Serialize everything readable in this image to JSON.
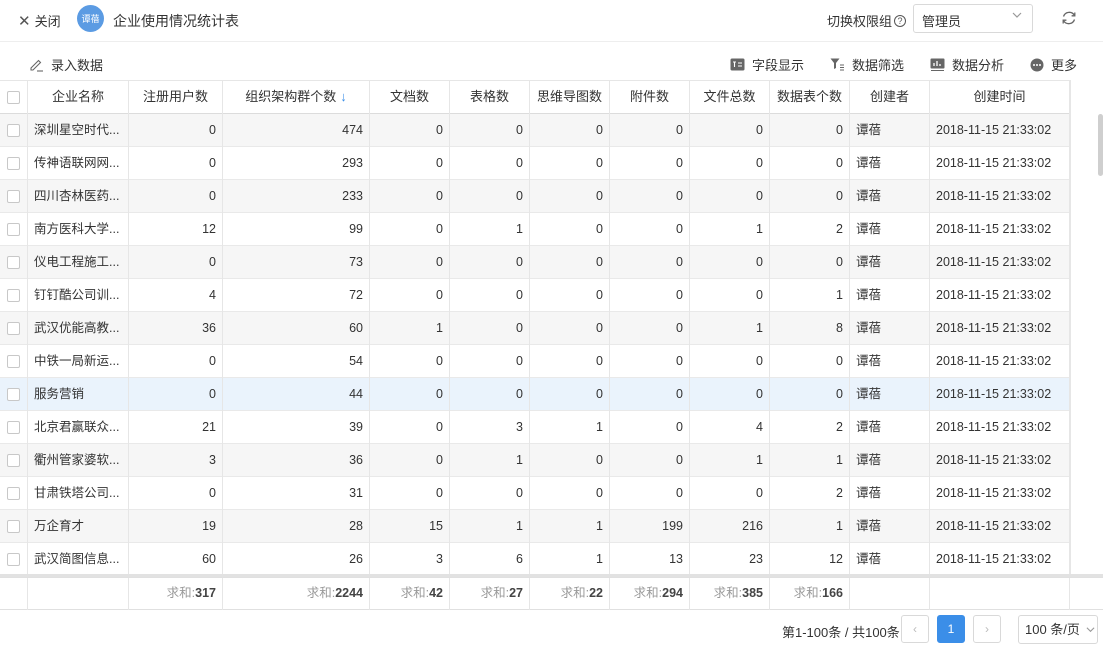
{
  "header": {
    "close_label": "关闭",
    "avatar_text": "谭蓓",
    "title": "企业使用情况统计表",
    "perm_label": "切换权限组",
    "perm_value": "管理员"
  },
  "toolbar": {
    "entry_label": "录入数据",
    "fields_label": "字段显示",
    "filter_label": "数据筛选",
    "analysis_label": "数据分析",
    "more_label": "更多"
  },
  "columns": [
    {
      "label": "企业名称"
    },
    {
      "label": "注册用户数"
    },
    {
      "label": "组织架构群个数",
      "sort": "↓"
    },
    {
      "label": "文档数"
    },
    {
      "label": "表格数"
    },
    {
      "label": "思维导图数"
    },
    {
      "label": "附件数"
    },
    {
      "label": "文件总数"
    },
    {
      "label": "数据表个数"
    },
    {
      "label": "创建者"
    },
    {
      "label": "创建时间"
    }
  ],
  "rows": [
    {
      "name": "深圳星空时代...",
      "users": "0",
      "groups": "474",
      "docs": "0",
      "sheets": "0",
      "minds": "0",
      "attach": "0",
      "files": "0",
      "tables": "0",
      "creator": "谭蓓",
      "created": "2018-11-15 21:33:02"
    },
    {
      "name": "传神语联网网...",
      "users": "0",
      "groups": "293",
      "docs": "0",
      "sheets": "0",
      "minds": "0",
      "attach": "0",
      "files": "0",
      "tables": "0",
      "creator": "谭蓓",
      "created": "2018-11-15 21:33:02"
    },
    {
      "name": "四川杏林医药...",
      "users": "0",
      "groups": "233",
      "docs": "0",
      "sheets": "0",
      "minds": "0",
      "attach": "0",
      "files": "0",
      "tables": "0",
      "creator": "谭蓓",
      "created": "2018-11-15 21:33:02"
    },
    {
      "name": "南方医科大学...",
      "users": "12",
      "groups": "99",
      "docs": "0",
      "sheets": "1",
      "minds": "0",
      "attach": "0",
      "files": "1",
      "tables": "2",
      "creator": "谭蓓",
      "created": "2018-11-15 21:33:02"
    },
    {
      "name": "仪电工程施工...",
      "users": "0",
      "groups": "73",
      "docs": "0",
      "sheets": "0",
      "minds": "0",
      "attach": "0",
      "files": "0",
      "tables": "0",
      "creator": "谭蓓",
      "created": "2018-11-15 21:33:02"
    },
    {
      "name": "钉钉酷公司训...",
      "users": "4",
      "groups": "72",
      "docs": "0",
      "sheets": "0",
      "minds": "0",
      "attach": "0",
      "files": "0",
      "tables": "1",
      "creator": "谭蓓",
      "created": "2018-11-15 21:33:02"
    },
    {
      "name": "武汉优能高教...",
      "users": "36",
      "groups": "60",
      "docs": "1",
      "sheets": "0",
      "minds": "0",
      "attach": "0",
      "files": "1",
      "tables": "8",
      "creator": "谭蓓",
      "created": "2018-11-15 21:33:02"
    },
    {
      "name": "中铁一局新运...",
      "users": "0",
      "groups": "54",
      "docs": "0",
      "sheets": "0",
      "minds": "0",
      "attach": "0",
      "files": "0",
      "tables": "0",
      "creator": "谭蓓",
      "created": "2018-11-15 21:33:02"
    },
    {
      "name": "服务营销",
      "users": "0",
      "groups": "44",
      "docs": "0",
      "sheets": "0",
      "minds": "0",
      "attach": "0",
      "files": "0",
      "tables": "0",
      "creator": "谭蓓",
      "created": "2018-11-15 21:33:02"
    },
    {
      "name": "北京君赢联众...",
      "users": "21",
      "groups": "39",
      "docs": "0",
      "sheets": "3",
      "minds": "1",
      "attach": "0",
      "files": "4",
      "tables": "2",
      "creator": "谭蓓",
      "created": "2018-11-15 21:33:02"
    },
    {
      "name": "衢州管家婆软...",
      "users": "3",
      "groups": "36",
      "docs": "0",
      "sheets": "1",
      "minds": "0",
      "attach": "0",
      "files": "1",
      "tables": "1",
      "creator": "谭蓓",
      "created": "2018-11-15 21:33:02"
    },
    {
      "name": "甘肃铁塔公司...",
      "users": "0",
      "groups": "31",
      "docs": "0",
      "sheets": "0",
      "minds": "0",
      "attach": "0",
      "files": "0",
      "tables": "2",
      "creator": "谭蓓",
      "created": "2018-11-15 21:33:02"
    },
    {
      "name": "万企育才",
      "users": "19",
      "groups": "28",
      "docs": "15",
      "sheets": "1",
      "minds": "1",
      "attach": "199",
      "files": "216",
      "tables": "1",
      "creator": "谭蓓",
      "created": "2018-11-15 21:33:02"
    },
    {
      "name": "武汉简图信息...",
      "users": "60",
      "groups": "26",
      "docs": "3",
      "sheets": "6",
      "minds": "1",
      "attach": "13",
      "files": "23",
      "tables": "12",
      "creator": "谭蓓",
      "created": "2018-11-15 21:33:02"
    }
  ],
  "totals": {
    "prefix": "求和:",
    "users": "317",
    "groups": "2244",
    "docs": "42",
    "sheets": "27",
    "minds": "22",
    "attach": "294",
    "files": "385",
    "tables": "166"
  },
  "pagination": {
    "info": "第1-100条 / 共100条",
    "prev": "‹",
    "current": "1",
    "next": "›",
    "page_size": "100 条/页"
  },
  "colors": {
    "accent": "#3b8ee8",
    "row_alt": "#f6f6f6",
    "row_highlight": "#eaf3fc"
  }
}
